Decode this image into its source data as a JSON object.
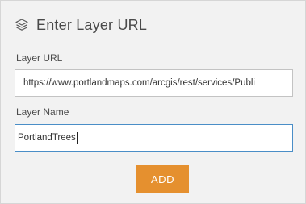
{
  "dialog": {
    "title": "Enter Layer URL",
    "icon": "layers-icon"
  },
  "layer_url": {
    "label": "Layer URL",
    "value": "https://www.portlandmaps.com/arcgis/rest/services/Publi"
  },
  "layer_name": {
    "label": "Layer Name",
    "value": "PortlandTrees"
  },
  "actions": {
    "add_label": "ADD"
  },
  "colors": {
    "accent": "#e5902f",
    "focus_border": "#4a8ec7",
    "panel_background": "#f2f2f2"
  }
}
